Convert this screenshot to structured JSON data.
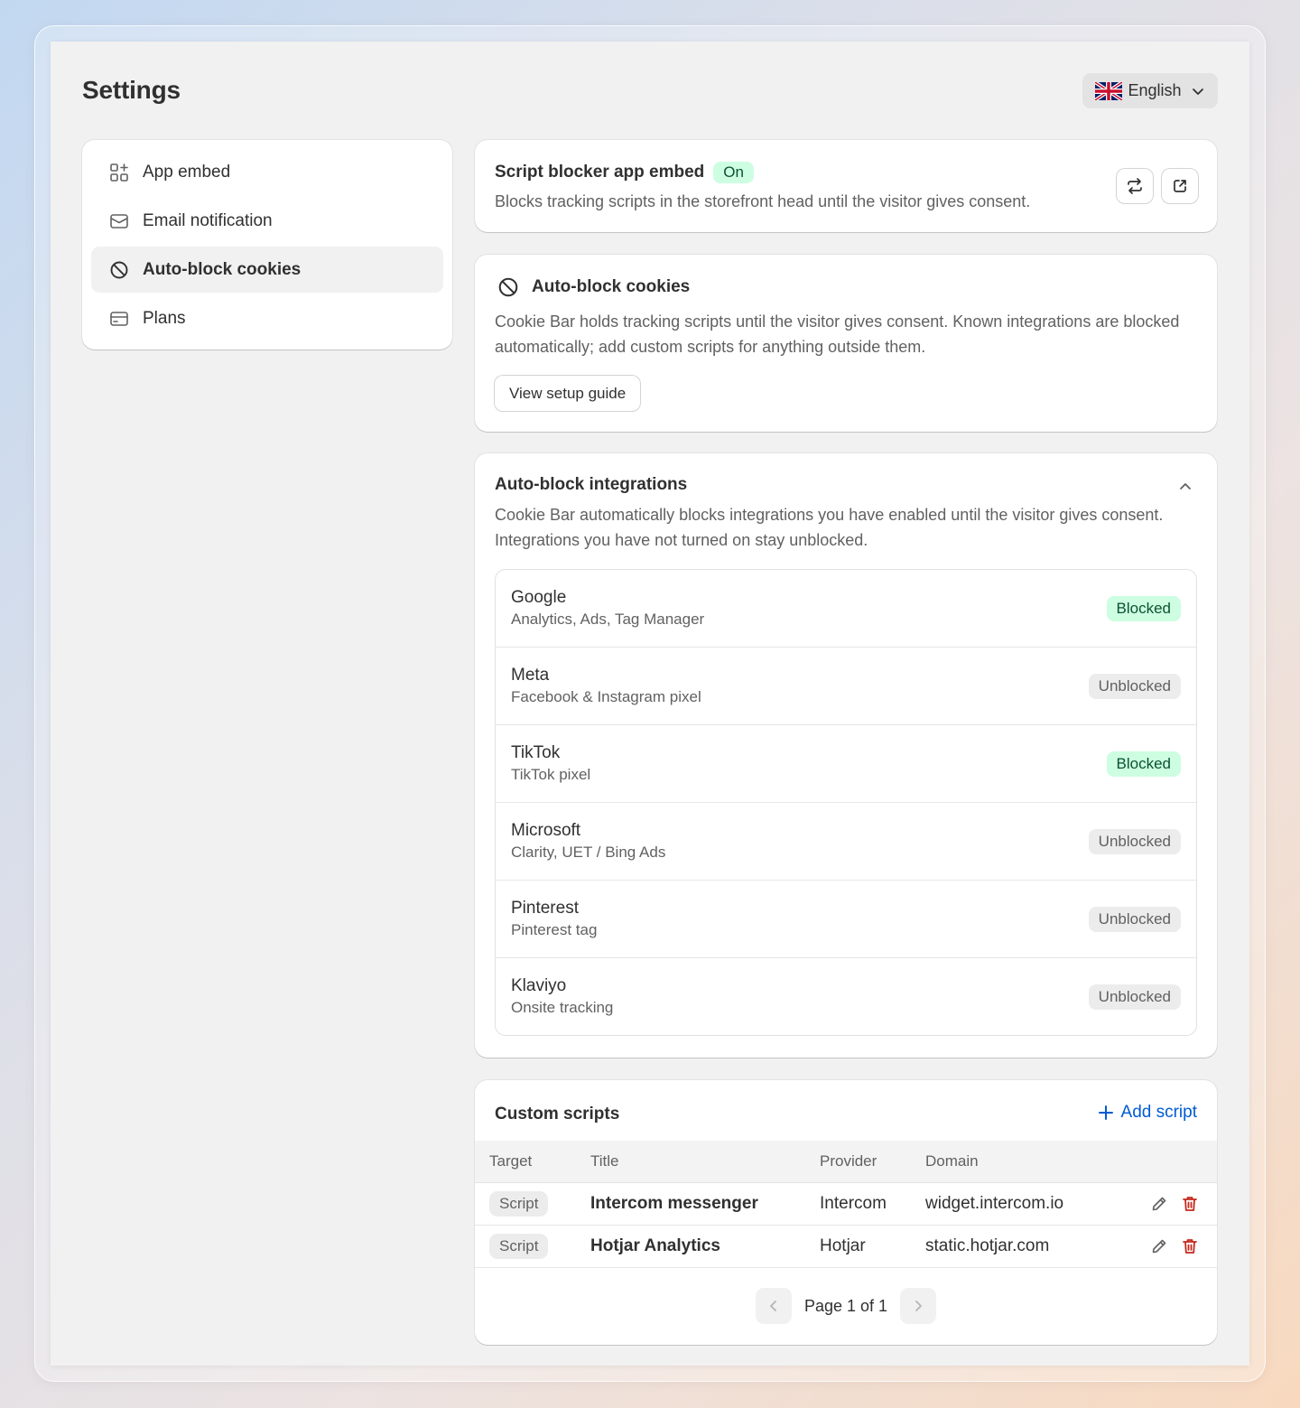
{
  "page": {
    "title": "Settings"
  },
  "language": {
    "selected": "English",
    "flag_icon": "uk-flag-icon"
  },
  "sidebar": {
    "items": [
      {
        "label": "App embed",
        "icon": "app-embed-icon",
        "active": false
      },
      {
        "label": "Email notification",
        "icon": "envelope-icon",
        "active": false
      },
      {
        "label": "Auto-block cookies",
        "icon": "block-icon",
        "active": true
      },
      {
        "label": "Plans",
        "icon": "credit-card-icon",
        "active": false
      }
    ]
  },
  "embed": {
    "title": "Script blocker app embed",
    "status": "On",
    "description": "Blocks tracking scripts in the storefront head until the visitor gives consent.",
    "refresh_icon": "refresh-icon",
    "external_icon": "external-link-icon"
  },
  "autoblock": {
    "title": "Auto-block cookies",
    "description": "Cookie Bar holds tracking scripts until the visitor gives consent. Known integrations are blocked automatically; add custom scripts for anything outside them.",
    "guide_button": "View setup guide"
  },
  "integrations": {
    "title": "Auto-block integrations",
    "description": "Cookie Bar automatically blocks integrations you have enabled until the visitor gives consent. Integrations you have not turned on stay unblocked.",
    "items": [
      {
        "name": "Google",
        "sub": "Analytics, Ads, Tag Manager",
        "status": "Blocked"
      },
      {
        "name": "Meta",
        "sub": "Facebook & Instagram pixel",
        "status": "Unblocked"
      },
      {
        "name": "TikTok",
        "sub": "TikTok pixel",
        "status": "Blocked"
      },
      {
        "name": "Microsoft",
        "sub": "Clarity, UET / Bing Ads",
        "status": "Unblocked"
      },
      {
        "name": "Pinterest",
        "sub": "Pinterest tag",
        "status": "Unblocked"
      },
      {
        "name": "Klaviyo",
        "sub": "Onsite tracking",
        "status": "Unblocked"
      }
    ]
  },
  "custom_scripts": {
    "title": "Custom scripts",
    "add_label": "Add script",
    "columns": {
      "target": "Target",
      "title": "Title",
      "provider": "Provider",
      "domain": "Domain"
    },
    "rows": [
      {
        "target": "Script",
        "title": "Intercom messenger",
        "provider": "Intercom",
        "domain": "widget.intercom.io"
      },
      {
        "target": "Script",
        "title": "Hotjar Analytics",
        "provider": "Hotjar",
        "domain": "static.hotjar.com"
      }
    ],
    "pagination": "Page 1 of 1"
  },
  "colors": {
    "accent": "#005bd3",
    "blocked_bg": "#cdfee1",
    "blocked_text": "#0c5132",
    "delete": "#c4291c"
  }
}
